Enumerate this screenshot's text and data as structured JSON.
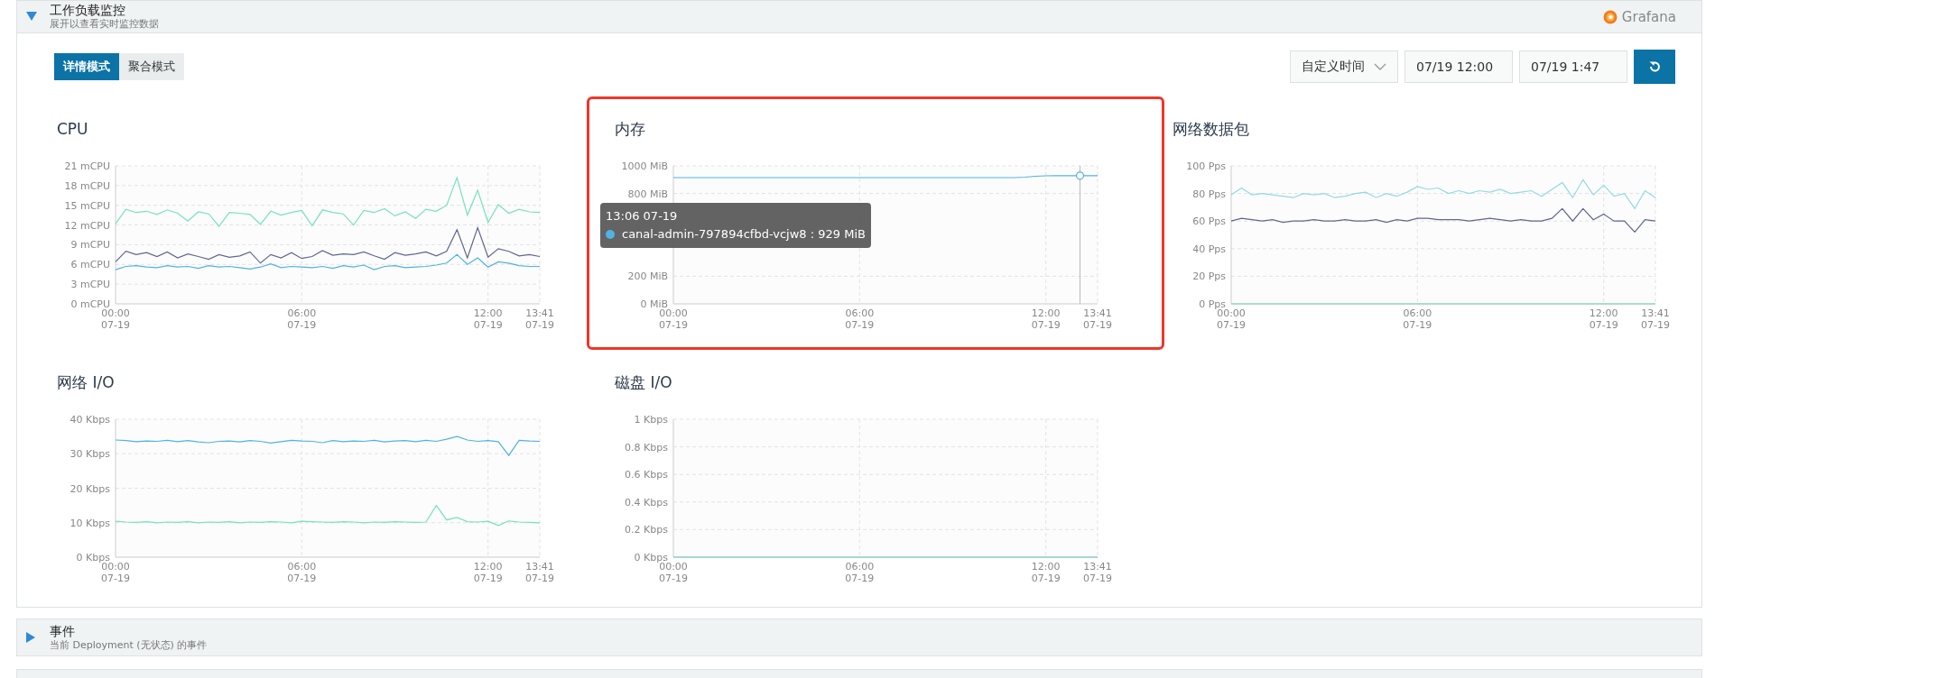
{
  "workload_section": {
    "title": "工作负载监控",
    "subtitle": "展开以查看实时监控数据",
    "expanded": true,
    "logo_text": "Grafana",
    "modes": [
      {
        "label": "详情模式",
        "selected": true
      },
      {
        "label": "聚合模式",
        "selected": false
      }
    ],
    "time_range": {
      "preset": "自定义时间",
      "start": "07/19 12:00",
      "end": "07/19 1:47"
    },
    "panels": [
      {
        "title": "CPU",
        "highlighted": false,
        "chart_data": {
          "type": "line",
          "categories": [
            "00:00\n07-19",
            null,
            null,
            null,
            null,
            null,
            null,
            null,
            null,
            null,
            null,
            null,
            null,
            null,
            null,
            null,
            null,
            null,
            "06:00\n07-19",
            null,
            null,
            null,
            null,
            null,
            null,
            null,
            null,
            null,
            null,
            null,
            null,
            null,
            null,
            null,
            null,
            null,
            "12:00\n07-19",
            null,
            null,
            null,
            null,
            "13:41\n07-19"
          ],
          "ylim": [
            0,
            21
          ],
          "grid": true,
          "yticks": [
            {
              "value": 0,
              "label": "0 mCPU"
            },
            {
              "value": 3,
              "label": "3 mCPU"
            },
            {
              "value": 6,
              "label": "6 mCPU"
            },
            {
              "value": 9,
              "label": "9 mCPU"
            },
            {
              "value": 12,
              "label": "12 mCPU"
            },
            {
              "value": 15,
              "label": "15 mCPU"
            },
            {
              "value": 18,
              "label": "18 mCPU"
            },
            {
              "value": 21,
              "label": "21 mCPU"
            }
          ],
          "series": [
            {
              "color": "#74e3bd",
              "values": [
                12.2,
                14.4,
                13.9,
                14.1,
                13.6,
                14.3,
                13.8,
                12.6,
                14.0,
                13.7,
                11.8,
                13.9,
                13.8,
                13.6,
                12.1,
                14.1,
                13.5,
                13.9,
                14.2,
                11.9,
                14.3,
                13.9,
                13.7,
                12.0,
                14.2,
                13.9,
                14.5,
                13.4,
                14.0,
                13.0,
                14.4,
                14.1,
                15.0,
                19.2,
                13.5,
                17.3,
                12.4,
                15.1,
                13.8,
                14.4,
                14.0,
                13.9
              ]
            },
            {
              "color": "#5f6690",
              "values": [
                6.4,
                8.0,
                7.5,
                7.8,
                7.2,
                7.9,
                7.0,
                7.6,
                7.2,
                6.8,
                7.5,
                7.1,
                7.3,
                7.9,
                6.2,
                7.5,
                7.0,
                7.8,
                6.9,
                7.2,
                8.1,
                7.4,
                7.6,
                7.5,
                7.9,
                7.3,
                6.8,
                7.8,
                7.4,
                7.6,
                7.9,
                7.3,
                8.0,
                11.3,
                7.0,
                11.6,
                7.1,
                8.4,
                8.0,
                7.3,
                7.5,
                7.2
              ]
            },
            {
              "color": "#4fb3e3",
              "values": [
                5.2,
                5.7,
                5.8,
                5.6,
                5.5,
                5.8,
                5.6,
                5.7,
                5.4,
                5.8,
                5.6,
                5.7,
                5.5,
                5.3,
                5.6,
                6.1,
                5.5,
                5.7,
                5.6,
                5.5,
                5.7,
                5.4,
                5.8,
                5.6,
                5.9,
                5.2,
                5.7,
                5.8,
                5.5,
                5.6,
                5.7,
                5.9,
                6.2,
                7.5,
                6.0,
                7.0,
                5.6,
                6.4,
                6.2,
                5.8,
                5.7,
                5.7
              ]
            }
          ]
        }
      },
      {
        "title": "内存",
        "highlighted": true,
        "tooltip": {
          "title": "13:06 07-19",
          "text": "canal-admin-797894cfbd-vcjw8 : 929 MiB",
          "color": "#4fb3e3"
        },
        "chart_data": {
          "type": "line",
          "categories": [
            "00:00\n07-19",
            null,
            null,
            null,
            null,
            null,
            null,
            null,
            null,
            null,
            null,
            null,
            null,
            null,
            null,
            null,
            null,
            null,
            "06:00\n07-19",
            null,
            null,
            null,
            null,
            null,
            null,
            null,
            null,
            null,
            null,
            null,
            null,
            null,
            null,
            null,
            null,
            null,
            "12:00\n07-19",
            null,
            null,
            null,
            null,
            "13:41\n07-19"
          ],
          "ylim": [
            0,
            1000
          ],
          "yticks": [
            {
              "value": 0,
              "label": "0 MiB"
            },
            {
              "value": 200,
              "label": "200 MiB"
            },
            {
              "value": 800,
              "label": "800 MiB"
            },
            {
              "value": 1000,
              "label": "1000 MiB"
            }
          ],
          "series": [
            {
              "color": "#4fb3e3",
              "values": [
                915,
                915,
                915,
                915,
                915,
                915,
                915,
                915,
                915,
                915,
                915,
                915,
                915,
                915,
                915,
                915,
                915,
                915,
                915,
                915,
                915,
                915,
                915,
                915,
                915,
                915,
                915,
                915,
                915,
                915,
                915,
                915,
                915,
                915,
                918,
                925,
                928,
                929,
                929,
                929,
                929,
                929
              ]
            }
          ],
          "grid": true
        }
      },
      {
        "title": "网络数据包",
        "highlighted": false,
        "chart_data": {
          "type": "line",
          "categories": [
            "00:00\n07-19",
            null,
            null,
            null,
            null,
            null,
            null,
            null,
            null,
            null,
            null,
            null,
            null,
            null,
            null,
            null,
            null,
            null,
            "06:00\n07-19",
            null,
            null,
            null,
            null,
            null,
            null,
            null,
            null,
            null,
            null,
            null,
            null,
            null,
            null,
            null,
            null,
            null,
            "12:00\n07-19",
            null,
            null,
            null,
            null,
            "13:41\n07-19"
          ],
          "ylim": [
            0,
            100
          ],
          "grid": true,
          "yticks": [
            {
              "value": 0,
              "label": "0 Pps"
            },
            {
              "value": 20,
              "label": "20 Pps"
            },
            {
              "value": 40,
              "label": "40 Pps"
            },
            {
              "value": 60,
              "label": "60 Pps"
            },
            {
              "value": 80,
              "label": "80 Pps"
            },
            {
              "value": 100,
              "label": "100 Pps"
            }
          ],
          "series": [
            {
              "color": "#8fdbe8",
              "values": [
                79,
                84,
                79,
                80,
                79,
                78,
                77,
                80,
                79,
                80,
                77,
                78,
                80,
                81,
                77,
                80,
                78,
                81,
                85,
                83,
                84,
                80,
                82,
                80,
                82,
                81,
                83,
                80,
                81,
                82,
                78,
                83,
                88,
                77,
                90,
                79,
                86,
                78,
                80,
                69,
                82,
                77
              ]
            },
            {
              "color": "#5f6690",
              "values": [
                60,
                62,
                61,
                60,
                61,
                59,
                60,
                60,
                61,
                60,
                60,
                61,
                60,
                60,
                61,
                59,
                61,
                60,
                62,
                62,
                61,
                61,
                61,
                60,
                61,
                62,
                61,
                60,
                61,
                60,
                60,
                62,
                69,
                60,
                69,
                61,
                65,
                60,
                60,
                52,
                61,
                60
              ]
            },
            {
              "color": "#7fcfb0",
              "values": [
                0,
                0,
                0,
                0,
                0,
                0,
                0,
                0,
                0,
                0,
                0,
                0,
                0,
                0,
                0,
                0,
                0,
                0,
                0,
                0,
                0,
                0,
                0,
                0,
                0,
                0,
                0,
                0,
                0,
                0,
                0,
                0,
                0,
                0,
                0,
                0,
                0,
                0,
                0,
                0,
                0,
                0
              ]
            }
          ]
        }
      },
      {
        "title": "网络 I/O",
        "highlighted": false,
        "chart_data": {
          "type": "line",
          "categories": [
            "00:00\n07-19",
            null,
            null,
            null,
            null,
            null,
            null,
            null,
            null,
            null,
            null,
            null,
            null,
            null,
            null,
            null,
            null,
            null,
            "06:00\n07-19",
            null,
            null,
            null,
            null,
            null,
            null,
            null,
            null,
            null,
            null,
            null,
            null,
            null,
            null,
            null,
            null,
            null,
            "12:00\n07-19",
            null,
            null,
            null,
            null,
            "13:41\n07-19"
          ],
          "ylim": [
            0,
            40
          ],
          "grid": true,
          "yticks": [
            {
              "value": 0,
              "label": "0 Kbps"
            },
            {
              "value": 10,
              "label": "10 Kbps"
            },
            {
              "value": 20,
              "label": "20 Kbps"
            },
            {
              "value": 30,
              "label": "30 Kbps"
            },
            {
              "value": 40,
              "label": "40 Kbps"
            }
          ],
          "series": [
            {
              "color": "#4fb3e3",
              "values": [
                34,
                33.8,
                33.5,
                33.7,
                33.6,
                33.9,
                33.5,
                33.8,
                33.4,
                33.2,
                33.6,
                33.7,
                33.4,
                33.8,
                33.6,
                33.1,
                33.5,
                33.9,
                33.7,
                33.6,
                33.2,
                33.8,
                33.5,
                33.7,
                33.6,
                33.9,
                33.4,
                33.7,
                33.8,
                33.5,
                33.9,
                33.6,
                34.2,
                35.0,
                34.0,
                33.6,
                33.8,
                33.5,
                29.5,
                33.9,
                33.7,
                33.6
              ]
            },
            {
              "color": "#74e3bd",
              "values": [
                10.4,
                10.2,
                10.1,
                10.3,
                10.0,
                10.2,
                10.1,
                10.3,
                10.0,
                10.2,
                10.1,
                10.3,
                10.0,
                10.2,
                10.1,
                10.3,
                10.2,
                10.0,
                10.4,
                10.3,
                10.2,
                10.1,
                10.3,
                10.2,
                10.0,
                10.2,
                10.1,
                10.3,
                10.2,
                10.1,
                10.2,
                15.0,
                10.8,
                11.5,
                10.3,
                10.2,
                10.4,
                9.2,
                10.5,
                10.2,
                10.1,
                10.0
              ]
            }
          ]
        }
      },
      {
        "title": "磁盘 I/O",
        "highlighted": false,
        "chart_data": {
          "type": "line",
          "categories": [
            "00:00\n07-19",
            null,
            null,
            null,
            null,
            null,
            null,
            null,
            null,
            null,
            null,
            null,
            null,
            null,
            null,
            null,
            null,
            null,
            "06:00\n07-19",
            null,
            null,
            null,
            null,
            null,
            null,
            null,
            null,
            null,
            null,
            null,
            null,
            null,
            null,
            null,
            null,
            null,
            "12:00\n07-19",
            null,
            null,
            null,
            null,
            "13:41\n07-19"
          ],
          "ylim": [
            0,
            1
          ],
          "grid": true,
          "yticks": [
            {
              "value": 0,
              "label": "0 Kbps"
            },
            {
              "value": 0.2,
              "label": "0.2 Kbps"
            },
            {
              "value": 0.4,
              "label": "0.4 Kbps"
            },
            {
              "value": 0.6,
              "label": "0.6 Kbps"
            },
            {
              "value": 0.8,
              "label": "0.8 Kbps"
            },
            {
              "value": 1,
              "label": "1 Kbps"
            }
          ],
          "series": [
            {
              "color": "#6cc7c0",
              "values": [
                0,
                0,
                0,
                0,
                0,
                0,
                0,
                0,
                0,
                0,
                0,
                0,
                0,
                0,
                0,
                0,
                0,
                0,
                0,
                0,
                0,
                0,
                0,
                0,
                0,
                0,
                0,
                0,
                0,
                0,
                0,
                0,
                0,
                0,
                0,
                0,
                0,
                0,
                0,
                0,
                0,
                0
              ]
            }
          ]
        }
      }
    ]
  },
  "sections": [
    {
      "title": "事件",
      "subtitle": "当前 Deployment (无状态) 的事件",
      "expanded": false
    }
  ]
}
